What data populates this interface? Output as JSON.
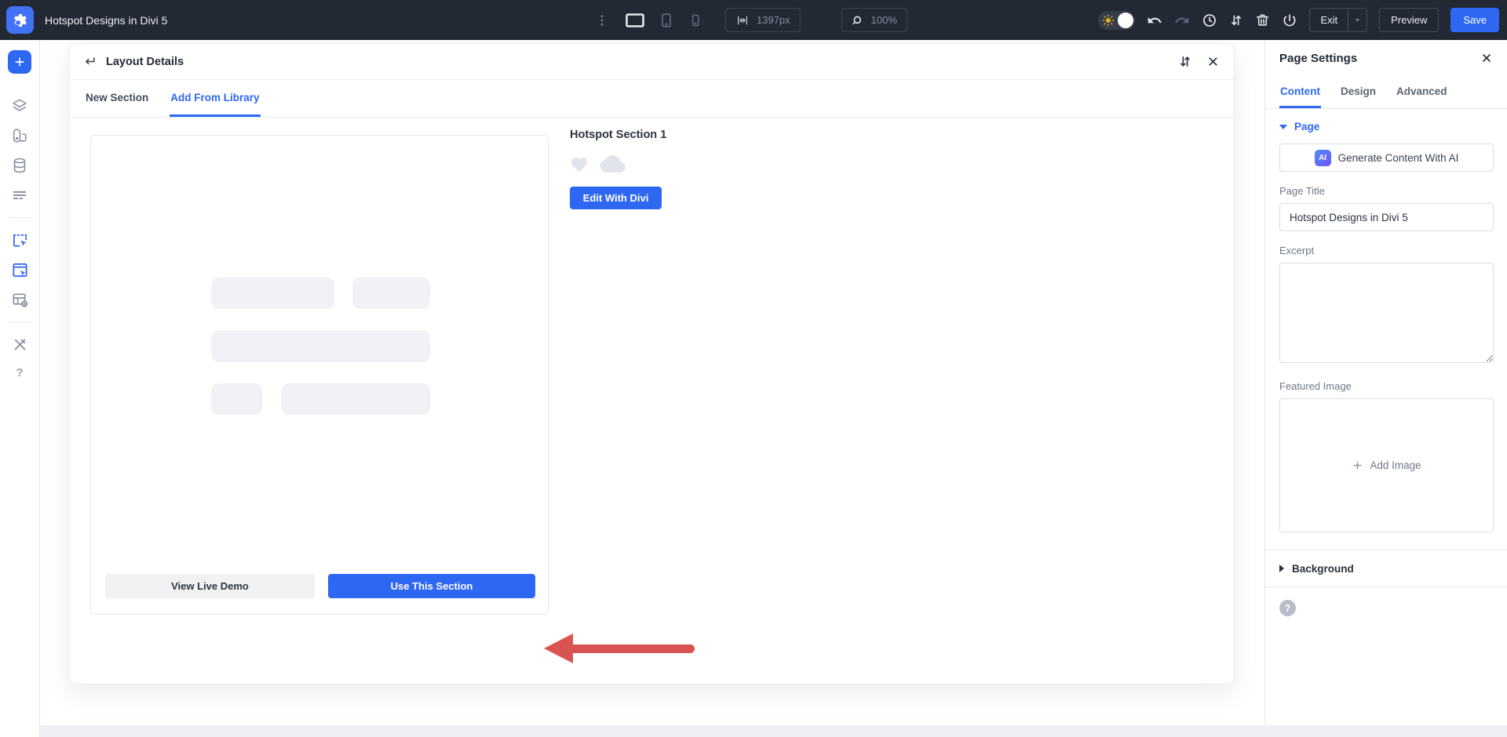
{
  "colors": {
    "topbar_bg": "#222834",
    "accent_blue": "#2e67f1",
    "logo_blue": "#4273f5",
    "arrow_red": "#d95450",
    "skeleton_gray": "#f0f2f6",
    "panel_border": "#e3e6ea"
  },
  "topbar": {
    "title": "Hotspot Designs in Divi 5",
    "width_value": "1397px",
    "zoom_value": "100%",
    "exit_label": "Exit",
    "preview_label": "Preview",
    "save_label": "Save",
    "icons": [
      "gear-logo",
      "kebab-menu",
      "desktop",
      "tablet",
      "phone",
      "width-arrows",
      "zoom-magnifier",
      "sun-toggle",
      "undo",
      "redo",
      "history-clock",
      "sort-arrows",
      "trash",
      "power",
      "caret-down"
    ]
  },
  "sidebar": {
    "icons": [
      "plus",
      "layers",
      "swatches",
      "database",
      "wireframe-rows",
      "insert-section",
      "insert-section-alt",
      "layout-library",
      "tools-wrench",
      "help"
    ]
  },
  "modal": {
    "title": "Layout Details",
    "tabs": [
      {
        "label": "New Section",
        "active": false
      },
      {
        "label": "Add From Library",
        "active": true
      }
    ],
    "preview_card": {
      "view_demo_label": "View Live Demo",
      "use_section_label": "Use This Section"
    },
    "section": {
      "name": "Hotspot Section 1",
      "edit_label": "Edit With Divi",
      "icons": [
        "heart",
        "cloud"
      ]
    }
  },
  "page_settings": {
    "title": "Page Settings",
    "tabs": [
      {
        "label": "Content",
        "active": true
      },
      {
        "label": "Design",
        "active": false
      },
      {
        "label": "Advanced",
        "active": false
      }
    ],
    "page_group": {
      "label": "Page",
      "ai_badge": "AI",
      "ai_button_label": "Generate Content With AI"
    },
    "fields": {
      "page_title": {
        "label": "Page Title",
        "value": "Hotspot Designs in Divi 5"
      },
      "excerpt": {
        "label": "Excerpt",
        "value": ""
      },
      "featured_image": {
        "label": "Featured Image",
        "add_label": "Add Image"
      }
    },
    "background": {
      "label": "Background"
    },
    "help_glyph": "?"
  }
}
